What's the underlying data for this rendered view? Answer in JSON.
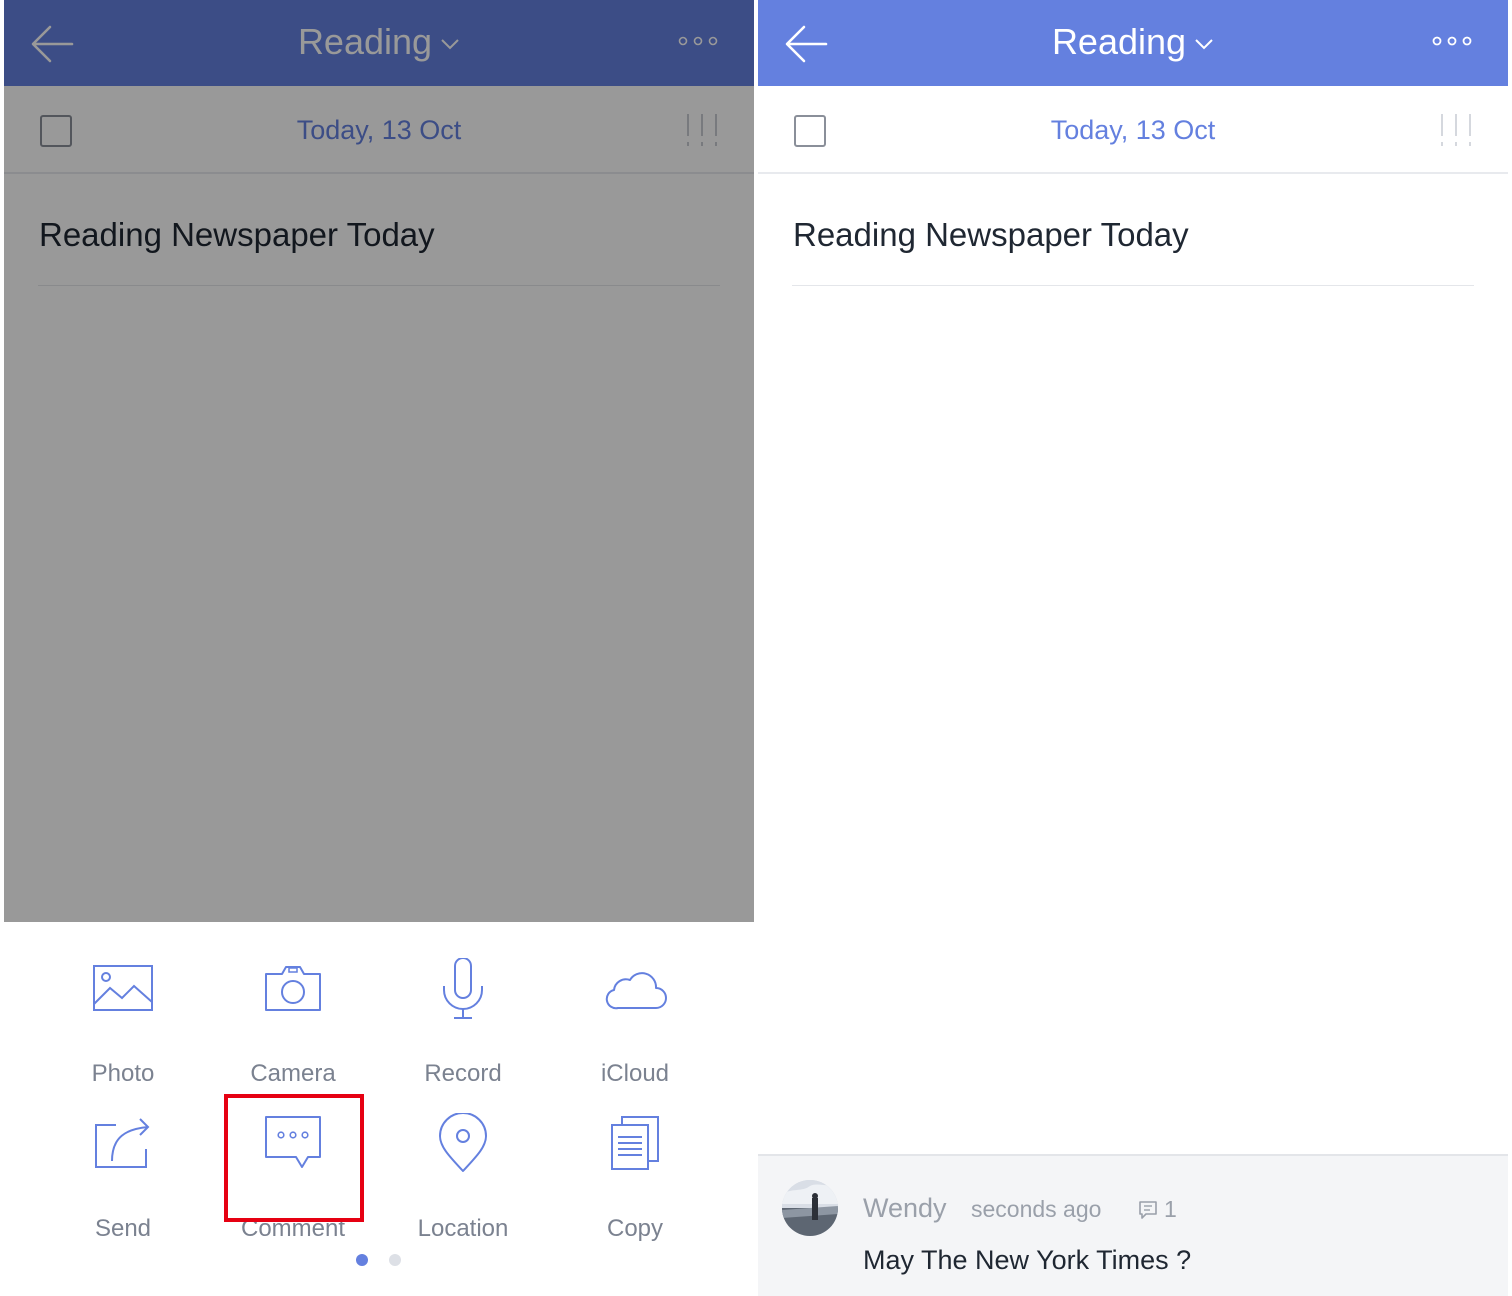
{
  "colors": {
    "accent": "#6480df",
    "highlight_box": "#e60012",
    "text_dark": "#1f2732",
    "text_muted": "#7b8290"
  },
  "left_screen": {
    "nav": {
      "title": "Reading",
      "back_icon": "arrow-left-icon",
      "more_icon": "ellipsis-icon"
    },
    "date": "Today, 13 Oct",
    "task_title": "Reading Newspaper Today",
    "actions": [
      {
        "label": "Photo",
        "icon": "photo-icon"
      },
      {
        "label": "Camera",
        "icon": "camera-icon"
      },
      {
        "label": "Record",
        "icon": "microphone-icon"
      },
      {
        "label": "iCloud",
        "icon": "cloud-icon"
      },
      {
        "label": "Send",
        "icon": "share-icon"
      },
      {
        "label": "Comment",
        "icon": "comment-bubble-icon"
      },
      {
        "label": "Location",
        "icon": "location-pin-icon"
      },
      {
        "label": "Copy",
        "icon": "copy-icon"
      }
    ],
    "highlighted_action": "Comment",
    "page_indicator": {
      "current": 1,
      "total": 2
    }
  },
  "right_screen": {
    "nav": {
      "title": "Reading"
    },
    "date": "Today, 13 Oct",
    "task_title": "Reading Newspaper Today",
    "comment": {
      "user": "Wendy",
      "time": "seconds ago",
      "count": "1",
      "text": "May The New York Times ?"
    }
  }
}
